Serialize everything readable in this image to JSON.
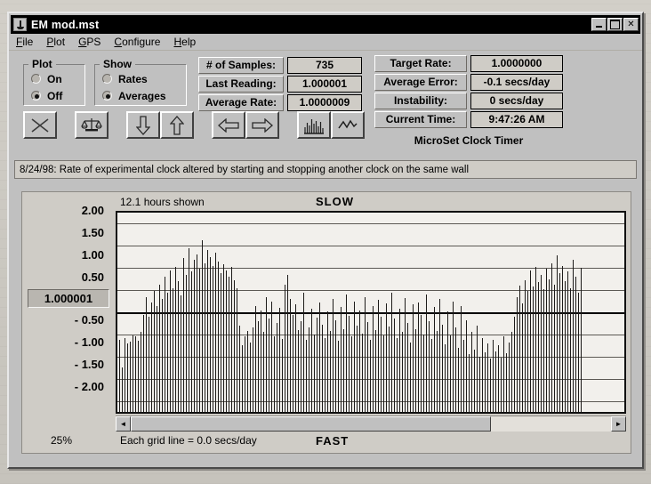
{
  "window": {
    "title": "EM mod.mst",
    "app_icon": "clock-timer-icon",
    "minimize_label": "_",
    "maximize_label": "□",
    "close_label": "✕"
  },
  "menu": [
    {
      "label": "File",
      "accel": "F"
    },
    {
      "label": "Plot",
      "accel": "P"
    },
    {
      "label": "GPS",
      "accel": "G"
    },
    {
      "label": "Configure",
      "accel": "C"
    },
    {
      "label": "Help",
      "accel": "H"
    }
  ],
  "groups": {
    "plot": {
      "legend": "Plot",
      "options": [
        {
          "label": "On",
          "selected": false
        },
        {
          "label": "Off",
          "selected": true
        }
      ]
    },
    "show": {
      "legend": "Show",
      "options": [
        {
          "label": "Rates",
          "selected": false
        },
        {
          "label": "Averages",
          "selected": true
        }
      ]
    }
  },
  "stats_left": [
    {
      "label": "# of Samples:",
      "value": "735"
    },
    {
      "label": "Last Reading:",
      "value": "1.000001"
    },
    {
      "label": "Average Rate:",
      "value": "1.0000009"
    }
  ],
  "stats_right": [
    {
      "label": "Target Rate:",
      "value": "1.0000000"
    },
    {
      "label": "Average Error:",
      "value": "-0.1 secs/day"
    },
    {
      "label": "Instability:",
      "value": "0 secs/day"
    },
    {
      "label": "Current Time:",
      "value": "9:47:26 AM"
    }
  ],
  "brand": "MicroSet Clock Timer",
  "toolbar": [
    {
      "name": "close-x-button",
      "icon": "x-icon"
    },
    {
      "name": "calibrate-button",
      "icon": "balance-scale-icon"
    },
    {
      "name": "scroll-down-button",
      "icon": "arrow-down-icon"
    },
    {
      "name": "scroll-up-button",
      "icon": "arrow-up-icon"
    },
    {
      "name": "pan-left-button",
      "icon": "arrow-left-icon"
    },
    {
      "name": "pan-right-button",
      "icon": "arrow-right-icon"
    },
    {
      "name": "bar-plot-button",
      "icon": "bar-chart-icon"
    },
    {
      "name": "line-plot-button",
      "icon": "line-chart-icon"
    }
  ],
  "comment": "8/24/98: Rate of experimental clock altered by starting and stopping another clock on the same wall",
  "chart_panel": {
    "hours_shown": "12.1 hours shown",
    "top_label": "SLOW",
    "bottom_label": "FAST",
    "zoom_percent": "25%",
    "grid_note": "Each grid line = 0.0 secs/day",
    "zero_value": "1.000001",
    "scroll_left_arrow": "◄",
    "scroll_right_arrow": "►"
  },
  "chart_data": {
    "type": "bar",
    "title": "",
    "subtitle": "12.1 hours shown",
    "xlabel": "",
    "ylabel": "",
    "ylim": [
      -2.25,
      2.25
    ],
    "grid": true,
    "legend": null,
    "annotations": {
      "above_axis": "SLOW",
      "below_axis": "FAST",
      "center_line_value": "1.000001",
      "grid_step_note": "Each grid line = 0.0 secs/day",
      "zoom": "25%",
      "samples": 735
    },
    "ytick_labels": [
      "2.00",
      "1.50",
      "1.00",
      "0.50",
      "1.000001",
      "- 0.50",
      "- 1.00",
      "- 1.50",
      "- 2.00"
    ],
    "ytick_values": [
      2.0,
      1.5,
      1.0,
      0.5,
      0.0,
      -0.5,
      -1.0,
      -1.5,
      -2.0
    ],
    "baseline": -2.25,
    "note": "Each bar runs from the bottom of the plot to its value; values are deviation in the displayed rate units.",
    "values": [
      -0.62,
      -1.25,
      -0.58,
      -0.7,
      -0.66,
      -0.52,
      -0.55,
      -0.64,
      -0.45,
      -0.05,
      0.35,
      -0.1,
      0.22,
      0.48,
      0.15,
      0.62,
      0.3,
      0.8,
      0.45,
      0.95,
      0.55,
      1.02,
      0.7,
      0.38,
      1.22,
      0.85,
      1.45,
      0.92,
      1.18,
      1.3,
      0.98,
      1.62,
      1.1,
      1.4,
      1.25,
      1.05,
      1.35,
      1.15,
      0.88,
      1.08,
      0.95,
      0.8,
      1.02,
      0.72,
      0.55,
      -0.3,
      -0.75,
      -0.55,
      -0.42,
      -0.68,
      -0.35,
      0.15,
      -0.2,
      0.05,
      -0.45,
      0.35,
      -0.15,
      0.25,
      -0.55,
      -0.25,
      0.1,
      -0.6,
      0.62,
      0.85,
      0.3,
      -0.05,
      0.18,
      -0.4,
      -0.2,
      0.45,
      -0.62,
      -0.35,
      0.08,
      -0.5,
      -0.12,
      0.22,
      -0.28,
      -0.58,
      0.02,
      -0.42,
      0.3,
      -0.18,
      -0.65,
      0.12,
      -0.38,
      0.4,
      -0.08,
      -0.55,
      0.25,
      -0.3,
      0.05,
      -0.48,
      0.35,
      -0.22,
      -0.62,
      0.15,
      -0.4,
      0.28,
      -0.1,
      -0.52,
      0.2,
      -0.32,
      0.45,
      -0.15,
      -0.58,
      0.08,
      -0.45,
      0.32,
      -0.25,
      -0.68,
      0.18,
      -0.38,
      0.22,
      -0.05,
      -0.5,
      0.4,
      -0.2,
      -0.6,
      0.12,
      -0.42,
      0.3,
      -0.28,
      -0.72,
      0.02,
      -0.52,
      0.25,
      -0.35,
      -0.8,
      0.15,
      -0.62,
      -0.18,
      -0.95,
      -0.45,
      -0.85,
      -0.3,
      -1.0,
      -0.58,
      -0.9,
      -0.7,
      -1.05,
      -0.62,
      -0.88,
      -0.75,
      -1.02,
      -0.55,
      -0.92,
      -0.68,
      -0.45,
      -0.1,
      0.35,
      0.6,
      0.2,
      0.72,
      0.48,
      0.95,
      0.58,
      1.02,
      0.68,
      0.85,
      0.52,
      0.98,
      0.75,
      1.1,
      0.62,
      1.28,
      0.88,
      1.05,
      0.7,
      0.92,
      0.55,
      1.18,
      0.8,
      0.45,
      1.0
    ]
  }
}
